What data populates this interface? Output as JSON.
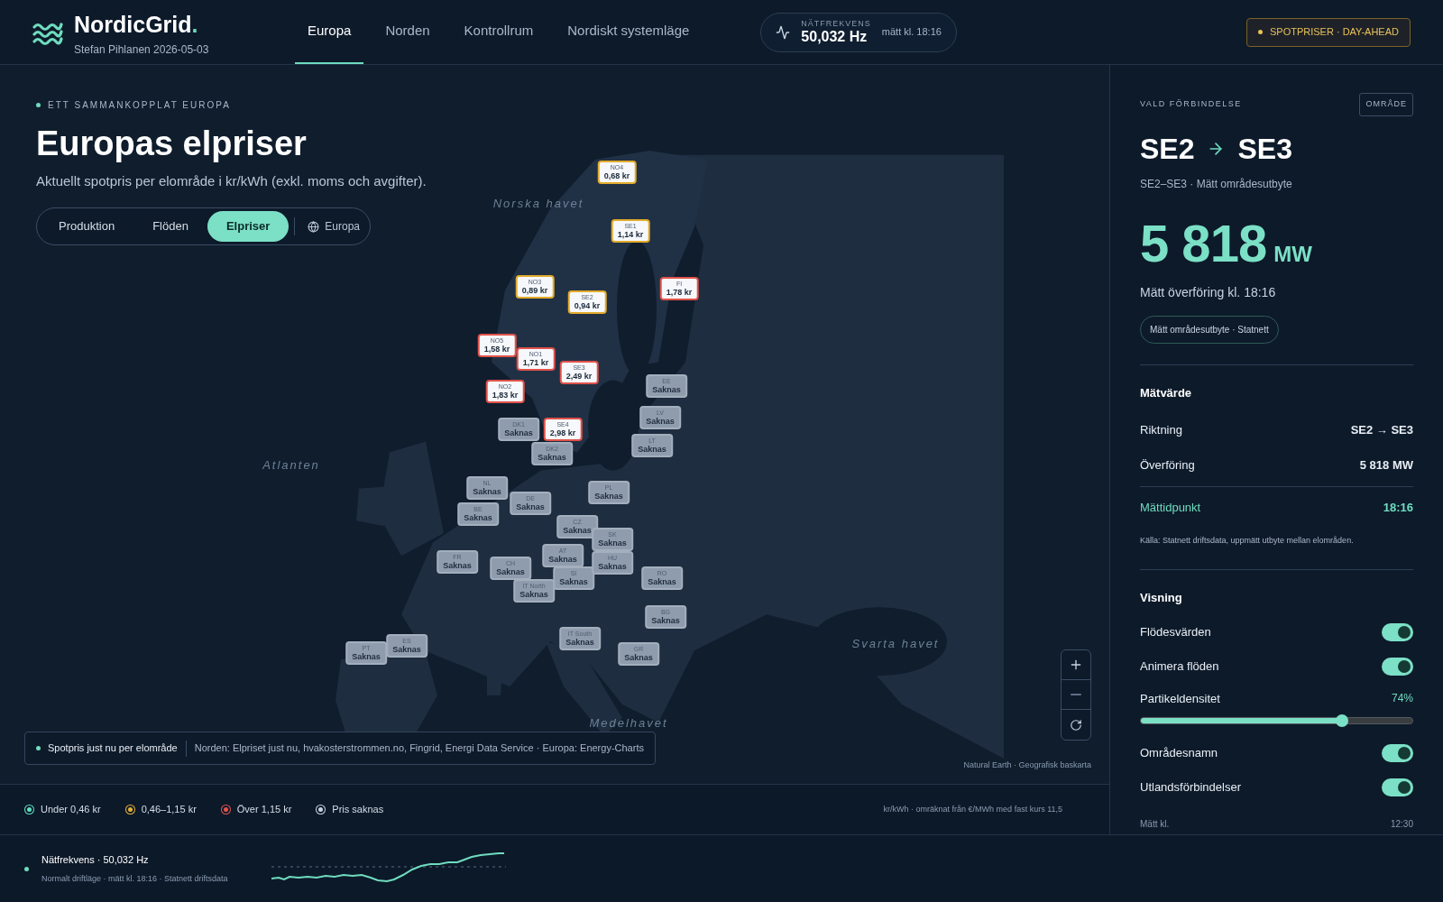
{
  "header": {
    "brand": "NordicGrid",
    "brand_mark": ".",
    "subtitle": "Stefan Pihlanen 2026-05-03",
    "nav": [
      {
        "label": "Europa",
        "selected": true
      },
      {
        "label": "Norden",
        "selected": false
      },
      {
        "label": "Kontrollrum",
        "selected": false
      },
      {
        "label": "Nordiskt systemläge",
        "selected": false
      }
    ],
    "frequency": {
      "label": "NÄTFREKVENS",
      "value": "50,032 Hz",
      "time": "mätt kl. 18:16"
    },
    "badge": "SPOTPRISER · DAY-AHEAD"
  },
  "map": {
    "eyebrow": "ETT SAMMANKOPPLAT EUROPA",
    "title": "Europas elpriser",
    "subtitle": "Aktuellt spotpris per elområde i kr/kWh (exkl. moms och avgifter).",
    "modes": [
      {
        "label": "Produktion",
        "selected": false
      },
      {
        "label": "Flöden",
        "selected": false
      },
      {
        "label": "Elpriser",
        "selected": true
      }
    ],
    "scope": "Europa",
    "seas": [
      "Norska havet",
      "Atlanten",
      "Medelhavet",
      "Svarta havet"
    ],
    "areas": [
      {
        "code": "NO4",
        "price": "0,68 kr",
        "color": "#e2ab2c",
        "missing": false
      },
      {
        "code": "SE1",
        "price": "1,14 kr",
        "color": "#e2ab2c",
        "missing": false
      },
      {
        "code": "NO3",
        "price": "0,89 kr",
        "color": "#e2ab2c",
        "missing": false
      },
      {
        "code": "SE2",
        "price": "0,94 kr",
        "color": "#e2ab2c",
        "missing": false
      },
      {
        "code": "FI",
        "price": "1,78 kr",
        "color": "#e0524a",
        "missing": false
      },
      {
        "code": "NO5",
        "price": "1,58 kr",
        "color": "#e0524a",
        "missing": false
      },
      {
        "code": "NO1",
        "price": "1,71 kr",
        "color": "#e0524a",
        "missing": false
      },
      {
        "code": "SE3",
        "price": "2,49 kr",
        "color": "#e0524a",
        "missing": false
      },
      {
        "code": "NO2",
        "price": "1,83 kr",
        "color": "#e0524a",
        "missing": false
      },
      {
        "code": "EE",
        "price": "Saknas",
        "color": "#a3afbd",
        "missing": true
      },
      {
        "code": "DK1",
        "price": "Saknas",
        "color": "#a3afbd",
        "missing": true
      },
      {
        "code": "SE4",
        "price": "2,98 kr",
        "color": "#e0524a",
        "missing": false
      },
      {
        "code": "DK2",
        "price": "Saknas",
        "color": "#a3afbd",
        "missing": true
      },
      {
        "code": "LV",
        "price": "Saknas",
        "color": "#a3afbd",
        "missing": true
      },
      {
        "code": "LT",
        "price": "Saknas",
        "color": "#a3afbd",
        "missing": true
      },
      {
        "code": "NL",
        "price": "Saknas",
        "color": "#a3afbd",
        "missing": true
      },
      {
        "code": "PL",
        "price": "Saknas",
        "color": "#a3afbd",
        "missing": true
      },
      {
        "code": "DE",
        "price": "Saknas",
        "color": "#a3afbd",
        "missing": true
      },
      {
        "code": "BE",
        "price": "Saknas",
        "color": "#a3afbd",
        "missing": true
      },
      {
        "code": "CZ",
        "price": "Saknas",
        "color": "#a3afbd",
        "missing": true
      },
      {
        "code": "SK",
        "price": "Saknas",
        "color": "#a3afbd",
        "missing": true
      },
      {
        "code": "AT",
        "price": "Saknas",
        "color": "#a3afbd",
        "missing": true
      },
      {
        "code": "FR",
        "price": "Saknas",
        "color": "#a3afbd",
        "missing": true
      },
      {
        "code": "CH",
        "price": "Saknas",
        "color": "#a3afbd",
        "missing": true
      },
      {
        "code": "SI",
        "price": "Saknas",
        "color": "#a3afbd",
        "missing": true
      },
      {
        "code": "HU",
        "price": "Saknas",
        "color": "#a3afbd",
        "missing": true
      },
      {
        "code": "IT North",
        "price": "Saknas",
        "color": "#a3afbd",
        "missing": true
      },
      {
        "code": "RO",
        "price": "Saknas",
        "color": "#a3afbd",
        "missing": true
      },
      {
        "code": "BG",
        "price": "Saknas",
        "color": "#a3afbd",
        "missing": true
      },
      {
        "code": "IT South",
        "price": "Saknas",
        "color": "#a3afbd",
        "missing": true
      },
      {
        "code": "GR",
        "price": "Saknas",
        "color": "#a3afbd",
        "missing": true
      },
      {
        "code": "ES",
        "price": "Saknas",
        "color": "#a3afbd",
        "missing": true
      },
      {
        "code": "PT",
        "price": "Saknas",
        "color": "#a3afbd",
        "missing": true
      }
    ],
    "info": {
      "label": "Spotpris just nu per elområde",
      "sources": "Norden: Elpriset just nu, hvakosterstrommen.no, Fingrid, Energi Data Service · Europa: Energy-Charts"
    },
    "attribution": "Natural Earth · Geografisk baskarta"
  },
  "legend": {
    "items": [
      {
        "label": "Under 0,46 kr",
        "color": "#5fe0c0"
      },
      {
        "label": "0,46–1,15 kr",
        "color": "#e8b23a"
      },
      {
        "label": "Över 1,15 kr",
        "color": "#e5534b"
      },
      {
        "label": "Pris saknas",
        "color": "#c9d4e0"
      }
    ],
    "note": "kr/kWh · omräknat från €/MWh med fast kurs 11,5"
  },
  "panel": {
    "eyebrow": "VALD FÖRBINDELSE",
    "tag": "OMRÅDE",
    "from": "SE2",
    "to": "SE3",
    "subtitle": "SE2–SE3 · Mätt områdesutbyte",
    "value": "5 818",
    "unit": "MW",
    "caption": "Mätt överföring kl. 18:16",
    "source_chip": "Mätt områdesutbyte · Statnett",
    "measure_title": "Mätvärde",
    "rows": [
      {
        "label": "Riktning",
        "value": "SE2 → SE3",
        "highlight": false
      },
      {
        "label": "Överföring",
        "value": "5 818 MW",
        "highlight": false
      },
      {
        "label": "Mättidpunkt",
        "value": "18:16",
        "highlight": true
      }
    ],
    "note": "Källa: Statnett driftsdata, uppmätt utbyte mellan elområden.",
    "view_title": "Visning",
    "settings": [
      {
        "kind": "toggle",
        "label": "Flödesvärden",
        "on": true
      },
      {
        "kind": "toggle",
        "label": "Animera flöden",
        "on": true
      },
      {
        "kind": "slider",
        "label": "Partikeldensitet",
        "reading": "74%",
        "level": 0.74
      },
      {
        "kind": "toggle",
        "label": "Områdesnamn",
        "on": true
      },
      {
        "kind": "toggle",
        "label": "Utlandsförbindelser",
        "on": true
      }
    ],
    "footer_label": "Mätt kl.",
    "footer_value": "12:30"
  },
  "status": {
    "title": "Nätfrekvens · 50,032 Hz",
    "detail": "Normalt driftläge · mätt kl. 18:16 · Statnett driftsdata"
  }
}
